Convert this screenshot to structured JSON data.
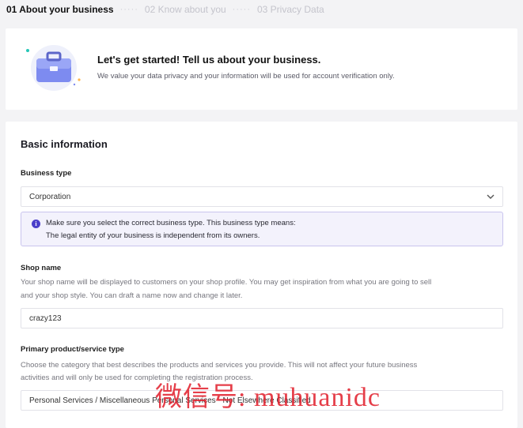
{
  "steps": [
    {
      "label": "01 About your business"
    },
    {
      "label": "02 Know about you"
    },
    {
      "label": "03 Privacy Data"
    }
  ],
  "step_separator": "·····",
  "intro": {
    "title": "Let's get started! Tell us about your business.",
    "subtitle": "We value your data privacy and your information will be used for account verification only."
  },
  "form": {
    "section_title": "Basic information",
    "business_type": {
      "label": "Business type",
      "value": "Corporation"
    },
    "notice": {
      "icon": "info-icon",
      "line1": "Make sure you select the correct business type. This business type means:",
      "line2": "The legal entity of your business is independent from its owners."
    },
    "shop_name": {
      "label": "Shop name",
      "helper_line1": "Your shop name will be displayed to customers on your shop profile. You may get inspiration from what you are going to sell",
      "helper_line2": "and your shop style. You can draft a name now and change it later.",
      "value": "crazy123"
    },
    "primary_type": {
      "label": "Primary product/service type",
      "helper_line1": "Choose the category that best describes the products and services you provide. This will not affect your future business",
      "helper_line2": "activities and will only be used for completing the registration process.",
      "value": "Personal Services / Miscellaneous Personal Services - Not Elsewhere Classified"
    }
  },
  "watermark": "微信号: muhuanidc",
  "colors": {
    "accent": "#4b3fc9",
    "notice_bg": "#f3f2fc",
    "watermark": "#e11d2a"
  }
}
